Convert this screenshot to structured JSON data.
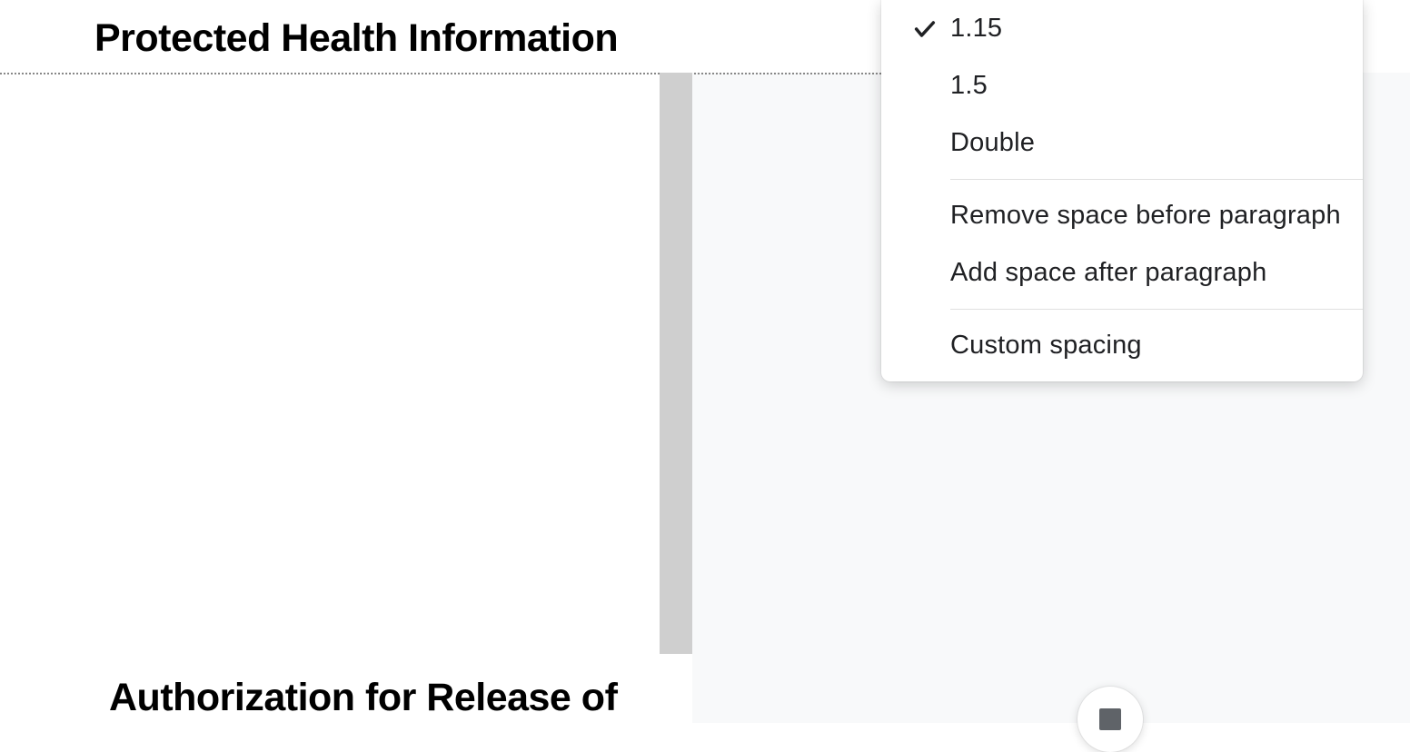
{
  "document": {
    "title_visible_page1": "Protected Health Information",
    "title_visible_page2": "Authorization for Release of"
  },
  "line_spacing_menu": {
    "options": [
      {
        "label": "1.15",
        "selected": true
      },
      {
        "label": "1.5",
        "selected": false
      },
      {
        "label": "Double",
        "selected": false
      }
    ],
    "paragraph_actions": [
      {
        "label": "Remove space before paragraph"
      },
      {
        "label": "Add space after paragraph"
      }
    ],
    "custom_action": {
      "label": "Custom spacing"
    }
  }
}
